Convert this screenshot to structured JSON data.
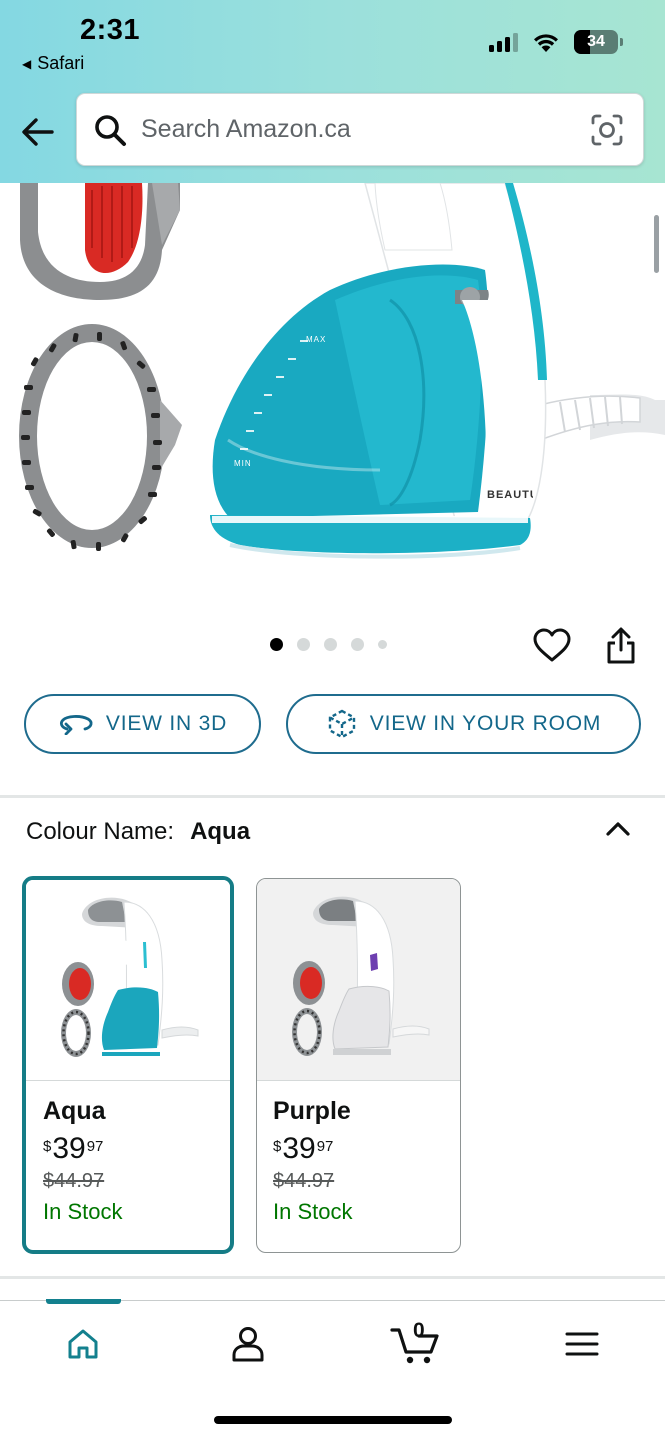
{
  "status_bar": {
    "time": "2:31",
    "back_app": "Safari",
    "battery": "34"
  },
  "search": {
    "placeholder": "Search Amazon.ca"
  },
  "product_image": {
    "brand_text": "BEAUTURAL",
    "tank_max": "MAX",
    "tank_min": "MIN"
  },
  "carousel": {
    "total_images": 5,
    "active_index": 0
  },
  "actions": {
    "view_3d": "VIEW IN 3D",
    "view_room": "VIEW IN YOUR ROOM"
  },
  "colour": {
    "label": "Colour Name:",
    "selected": "Aqua",
    "options": [
      {
        "name": "Aqua",
        "price_symbol": "$",
        "price_whole": "39",
        "price_fraction": "97",
        "list_price": "$44.97",
        "availability": "In Stock",
        "selected": true
      },
      {
        "name": "Purple",
        "price_symbol": "$",
        "price_whole": "39",
        "price_fraction": "97",
        "list_price": "$44.97",
        "availability": "In Stock",
        "selected": false
      }
    ]
  },
  "bottom_nav": {
    "cart_count": "0",
    "active_tab": "home"
  },
  "colors": {
    "header_gradient_start": "#84d8e2",
    "header_gradient_end": "#a7e5d2",
    "button_blue": "#13678a",
    "selected_border": "#157c86",
    "in_stock_green": "#007600",
    "aqua_product": "#1ba6bd"
  },
  "icons": {
    "back": "arrow-left-icon",
    "search": "magnifier-icon",
    "camera": "camera-lens-icon",
    "wishlist": "heart-icon",
    "share": "share-icon",
    "view_3d": "rotate-3d-icon",
    "view_room": "ar-cube-icon",
    "collapse": "chevron-up-icon",
    "home": "home-icon",
    "account": "person-icon",
    "cart": "cart-icon",
    "menu": "hamburger-icon"
  }
}
